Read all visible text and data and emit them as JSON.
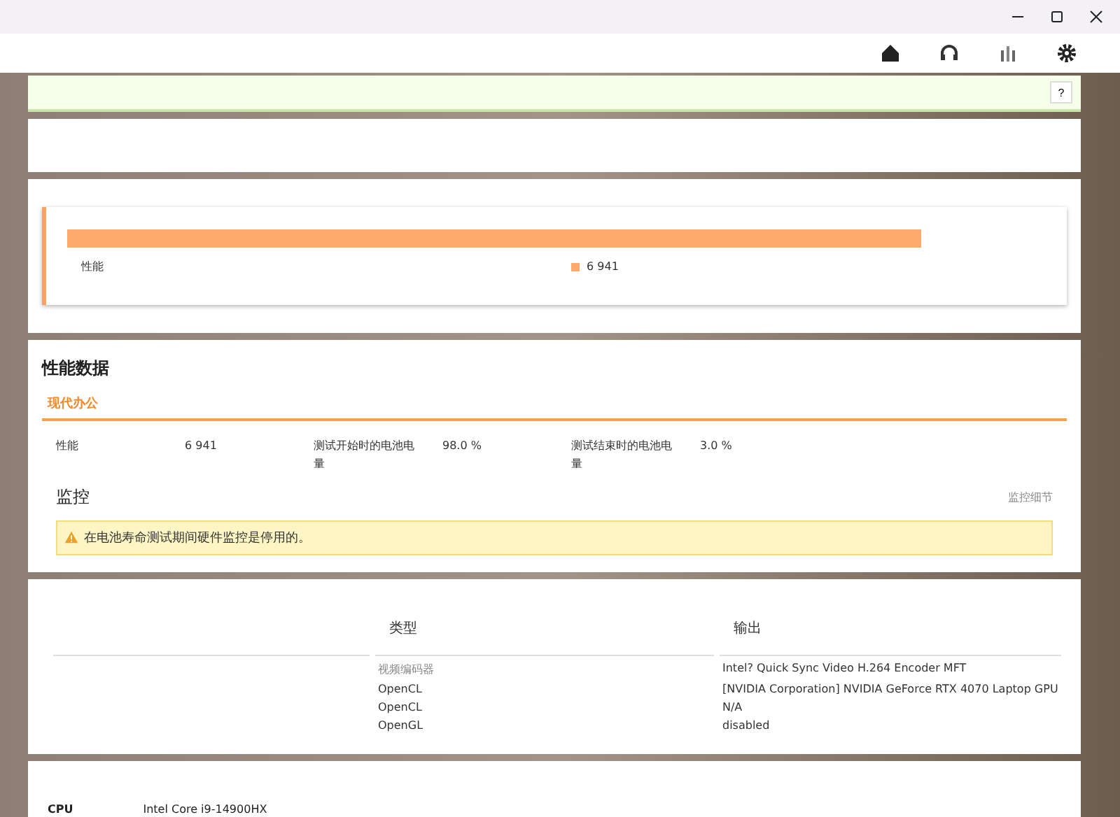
{
  "help_button": "?",
  "chart": {
    "category": "性能",
    "legend_value": "6 941"
  },
  "performance": {
    "title": "性能数据",
    "tab": {
      "label": "现代办公",
      "selected": true
    },
    "stats": [
      {
        "label": "性能",
        "value": "6 941"
      },
      {
        "label": "测试开始时的电池电量",
        "value": "98.0 %"
      },
      {
        "label": "测试结束时的电池电量",
        "value": "3.0 %"
      }
    ]
  },
  "monitoring": {
    "title": "监控",
    "details_link": "监控细节",
    "warning": "在电池寿命测试期间硬件监控是停用的。"
  },
  "table": {
    "columns": [
      "类型",
      "输出"
    ],
    "rows": [
      {
        "type": "视频编码器",
        "output": "Intel? Quick Sync Video H.264 Encoder MFT",
        "muted": true
      },
      {
        "type": "OpenCL",
        "output": "[NVIDIA Corporation] NVIDIA GeForce RTX 4070 Laptop GPU",
        "muted": false
      },
      {
        "type": "OpenCL",
        "output": "N/A",
        "muted": false
      },
      {
        "type": "OpenGL",
        "output": "disabled",
        "muted": false
      }
    ]
  },
  "system": {
    "label": "CPU",
    "value": "Intel Core i9-14900HX"
  }
}
